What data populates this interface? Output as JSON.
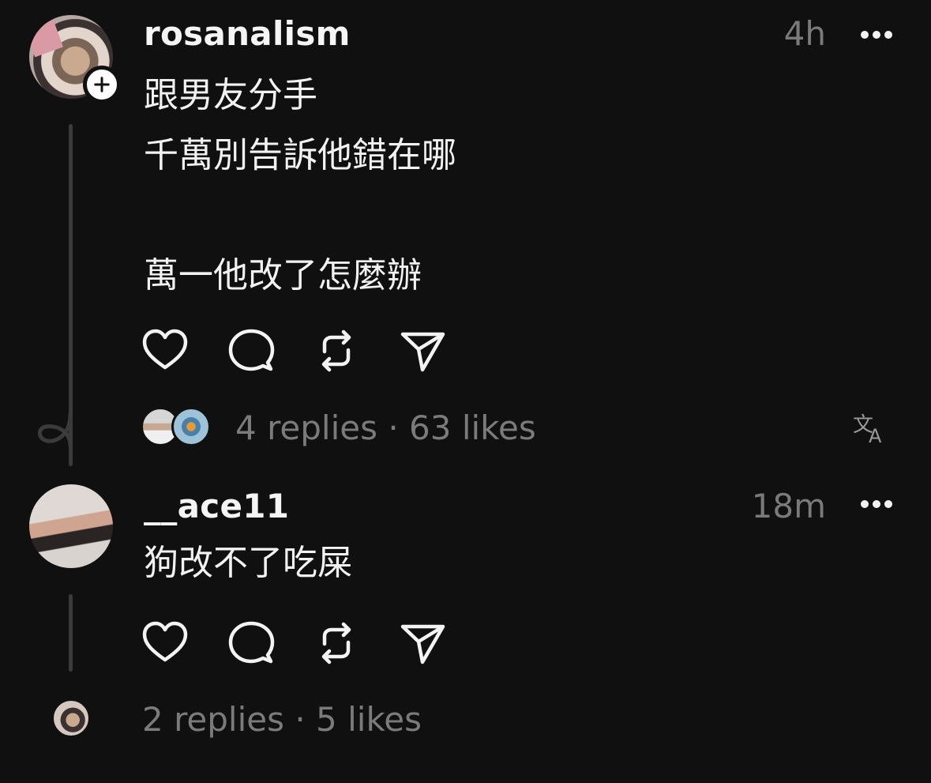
{
  "posts": [
    {
      "username": "rosanalism",
      "time": "4h",
      "body": "跟男友分手\n千萬別告訴他錯在哪\n\n萬一他改了怎麼辦",
      "stats": "4 replies · 63 likes"
    },
    {
      "username": "__ace11",
      "time": "18m",
      "body": "狗改不了吃屎",
      "stats": "2 replies · 5 likes"
    }
  ],
  "icons": {
    "like": "heart-icon",
    "reply": "comment-icon",
    "repost": "repost-icon",
    "share": "send-icon",
    "more": "more-dots-icon",
    "follow": "plus-icon",
    "translate": "translate-icon"
  },
  "colors": {
    "background": "#101010",
    "text": "#f3f3f3",
    "muted": "#7a7a7a",
    "thread_line": "#3b3b3b"
  }
}
